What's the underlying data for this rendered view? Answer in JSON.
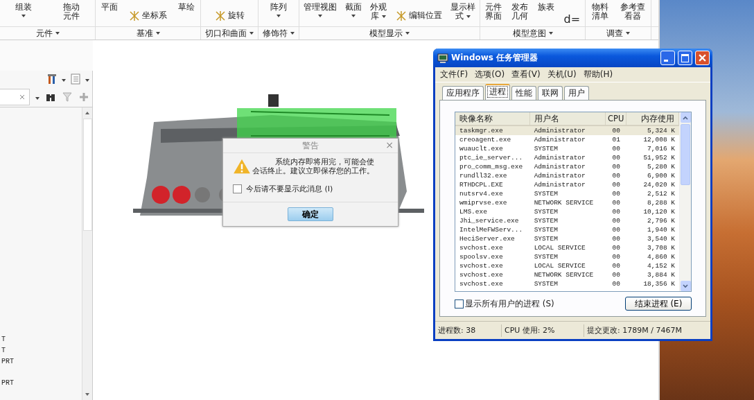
{
  "ribbon": {
    "groups": [
      {
        "label": "元件",
        "items": [
          {
            "lines": [
              "组装"
            ],
            "kind": "big",
            "dropdown": true
          },
          {
            "lines": [
              "拖动",
              "元件"
            ],
            "kind": "big"
          }
        ]
      },
      {
        "label": "基准",
        "items": [
          {
            "lines": [
              "平面"
            ],
            "kind": "big"
          },
          {
            "lines": [
              "坐标系"
            ],
            "kind": "small"
          },
          {
            "lines": [
              "草绘"
            ],
            "kind": "big"
          }
        ]
      },
      {
        "label": "切口和曲面",
        "items": [
          {
            "lines": [
              "旋转"
            ],
            "kind": "small"
          }
        ]
      },
      {
        "label": "修饰符",
        "items": [
          {
            "lines": [
              "阵列"
            ],
            "kind": "big",
            "dropdown": true
          }
        ]
      },
      {
        "label": "模型显示",
        "items": [
          {
            "lines": [
              "管理视图"
            ],
            "kind": "big",
            "dropdown": true
          },
          {
            "lines": [
              "截面"
            ],
            "kind": "big",
            "dropdown": true
          },
          {
            "lines": [
              "外观",
              "库"
            ],
            "kind": "big",
            "dropdown": true
          },
          {
            "lines": [
              "编辑位置"
            ],
            "kind": "small"
          },
          {
            "lines": [
              "显示样",
              "式"
            ],
            "kind": "big",
            "dropdown": true
          }
        ]
      },
      {
        "label": "模型意图",
        "items": [
          {
            "lines": [
              "元件",
              "界面"
            ],
            "kind": "big"
          },
          {
            "lines": [
              "发布",
              "几何"
            ],
            "kind": "big"
          },
          {
            "lines": [
              "族表"
            ],
            "kind": "big"
          },
          {
            "lines": [
              "d="
            ],
            "kind": "param"
          }
        ]
      },
      {
        "label": "调查",
        "items": [
          {
            "lines": [
              "物料",
              "清单"
            ],
            "kind": "big"
          },
          {
            "lines": [
              "参考查",
              "看器"
            ],
            "kind": "big"
          }
        ]
      }
    ]
  },
  "model_tree": {
    "items": [
      "T",
      "T",
      "PRT",
      "PRT"
    ]
  },
  "warning_dialog": {
    "title": "警告",
    "close": "×",
    "message": [
      "系统内存即将用完，可能会使",
      "会话终止。建议立即保存您的工作。"
    ],
    "checkbox": {
      "label": "今后请不要显示此消息 (I)",
      "checked": false
    },
    "button": "确定"
  },
  "task_manager": {
    "title": "Windows 任务管理器",
    "menu": [
      "文件(F)",
      "选项(O)",
      "查看(V)",
      "关机(U)",
      "帮助(H)"
    ],
    "tabs": [
      {
        "label": "应用程序",
        "selected": false
      },
      {
        "label": "进程",
        "selected": true
      },
      {
        "label": "性能",
        "selected": false
      },
      {
        "label": "联网",
        "selected": false
      },
      {
        "label": "用户",
        "selected": false
      }
    ],
    "columns": [
      "映像名称",
      "用户名",
      "CPU",
      "内存使用"
    ],
    "rows": [
      {
        "cells": [
          "taskmgr.exe",
          "Administrator",
          "00",
          "5,324 K"
        ],
        "selected": true
      },
      {
        "cells": [
          "creoagent.exe",
          "Administrator",
          "01",
          "12,008 K"
        ],
        "selected": false
      },
      {
        "cells": [
          "wuauclt.exe",
          "SYSTEM",
          "00",
          "7,016 K"
        ],
        "selected": false
      },
      {
        "cells": [
          "ptc_ie_server...",
          "Administrator",
          "00",
          "51,952 K"
        ],
        "selected": false
      },
      {
        "cells": [
          "pro_comm_msg.exe",
          "Administrator",
          "00",
          "5,280 K"
        ],
        "selected": false
      },
      {
        "cells": [
          "rundll32.exe",
          "Administrator",
          "00",
          "6,900 K"
        ],
        "selected": false
      },
      {
        "cells": [
          "RTHDCPL.EXE",
          "Administrator",
          "00",
          "24,020 K"
        ],
        "selected": false
      },
      {
        "cells": [
          "nutsrv4.exe",
          "SYSTEM",
          "00",
          "2,512 K"
        ],
        "selected": false
      },
      {
        "cells": [
          "wmiprvse.exe",
          "NETWORK SERVICE",
          "00",
          "8,288 K"
        ],
        "selected": false
      },
      {
        "cells": [
          "LMS.exe",
          "SYSTEM",
          "00",
          "10,120 K"
        ],
        "selected": false
      },
      {
        "cells": [
          "Jhi_service.exe",
          "SYSTEM",
          "00",
          "2,796 K"
        ],
        "selected": false
      },
      {
        "cells": [
          "IntelMeFWServ...",
          "SYSTEM",
          "00",
          "1,940 K"
        ],
        "selected": false
      },
      {
        "cells": [
          "HeciServer.exe",
          "SYSTEM",
          "00",
          "3,540 K"
        ],
        "selected": false
      },
      {
        "cells": [
          "svchost.exe",
          "LOCAL SERVICE",
          "00",
          "3,708 K"
        ],
        "selected": false
      },
      {
        "cells": [
          "spoolsv.exe",
          "SYSTEM",
          "00",
          "4,860 K"
        ],
        "selected": false
      },
      {
        "cells": [
          "svchost.exe",
          "LOCAL SERVICE",
          "00",
          "4,152 K"
        ],
        "selected": false
      },
      {
        "cells": [
          "svchost.exe",
          "NETWORK SERVICE",
          "00",
          "3,884 K"
        ],
        "selected": false
      },
      {
        "cells": [
          "svchost.exe",
          "SYSTEM",
          "00",
          "18,356 K"
        ],
        "selected": false
      }
    ],
    "show_all_users": {
      "label": "显示所有用户的进程 (S)",
      "checked": false
    },
    "end_button": "结束进程 (E)",
    "status": [
      "进程数: 38",
      "CPU 使用: 2%",
      "提交更改: 1789M / 7467M"
    ]
  }
}
